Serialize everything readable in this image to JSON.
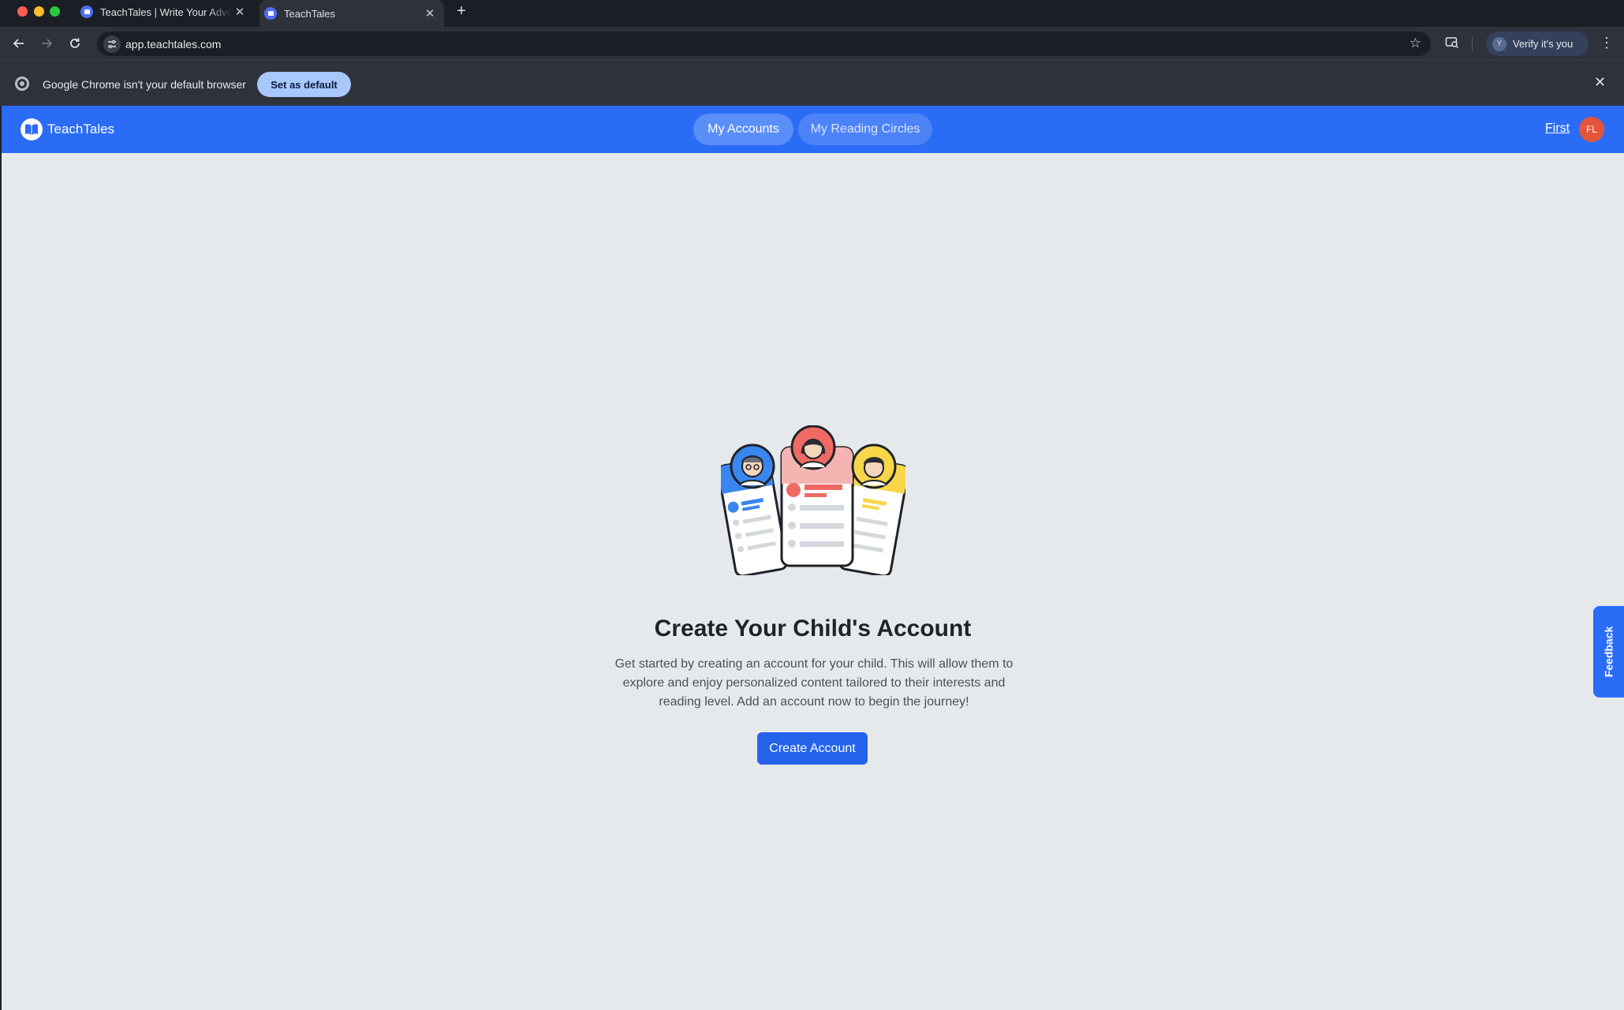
{
  "browser": {
    "tabs": [
      {
        "title": "TeachTales | Write Your Adventure",
        "active": false
      },
      {
        "title": "TeachTales",
        "active": true
      }
    ],
    "url": "app.teachtales.com",
    "profile_button": "Verify it's you",
    "infobar": {
      "message": "Google Chrome isn't your default browser",
      "action": "Set as default"
    }
  },
  "app": {
    "brand": "TeachTales",
    "nav": [
      {
        "label": "My Accounts",
        "active": true
      },
      {
        "label": "My Reading Circles",
        "active": false
      }
    ],
    "user": {
      "name": "First",
      "initials": "FL"
    },
    "empty_state": {
      "title": "Create Your Child's Account",
      "description": "Get started by creating an account for your child. This will allow them to explore and enjoy personalized content tailored to their interests and reading level. Add an account now to begin the journey!",
      "button": "Create Account"
    },
    "feedback_label": "Feedback"
  },
  "colors": {
    "brand_blue": "#2b6cf6",
    "button_blue": "#2563eb",
    "page_bg": "#e6e9ec",
    "avatar_red": "#e2553b",
    "card_blue": "#3a86f0",
    "card_red": "#ef6a63",
    "card_yellow": "#f7d64a"
  },
  "icons": [
    "back-arrow-icon",
    "forward-arrow-icon",
    "reload-icon",
    "site-settings-icon",
    "bookmark-star-icon",
    "search-tabs-icon",
    "chrome-logo-icon",
    "close-icon",
    "plus-icon",
    "menu-kebab-icon",
    "book-logo-icon"
  ]
}
